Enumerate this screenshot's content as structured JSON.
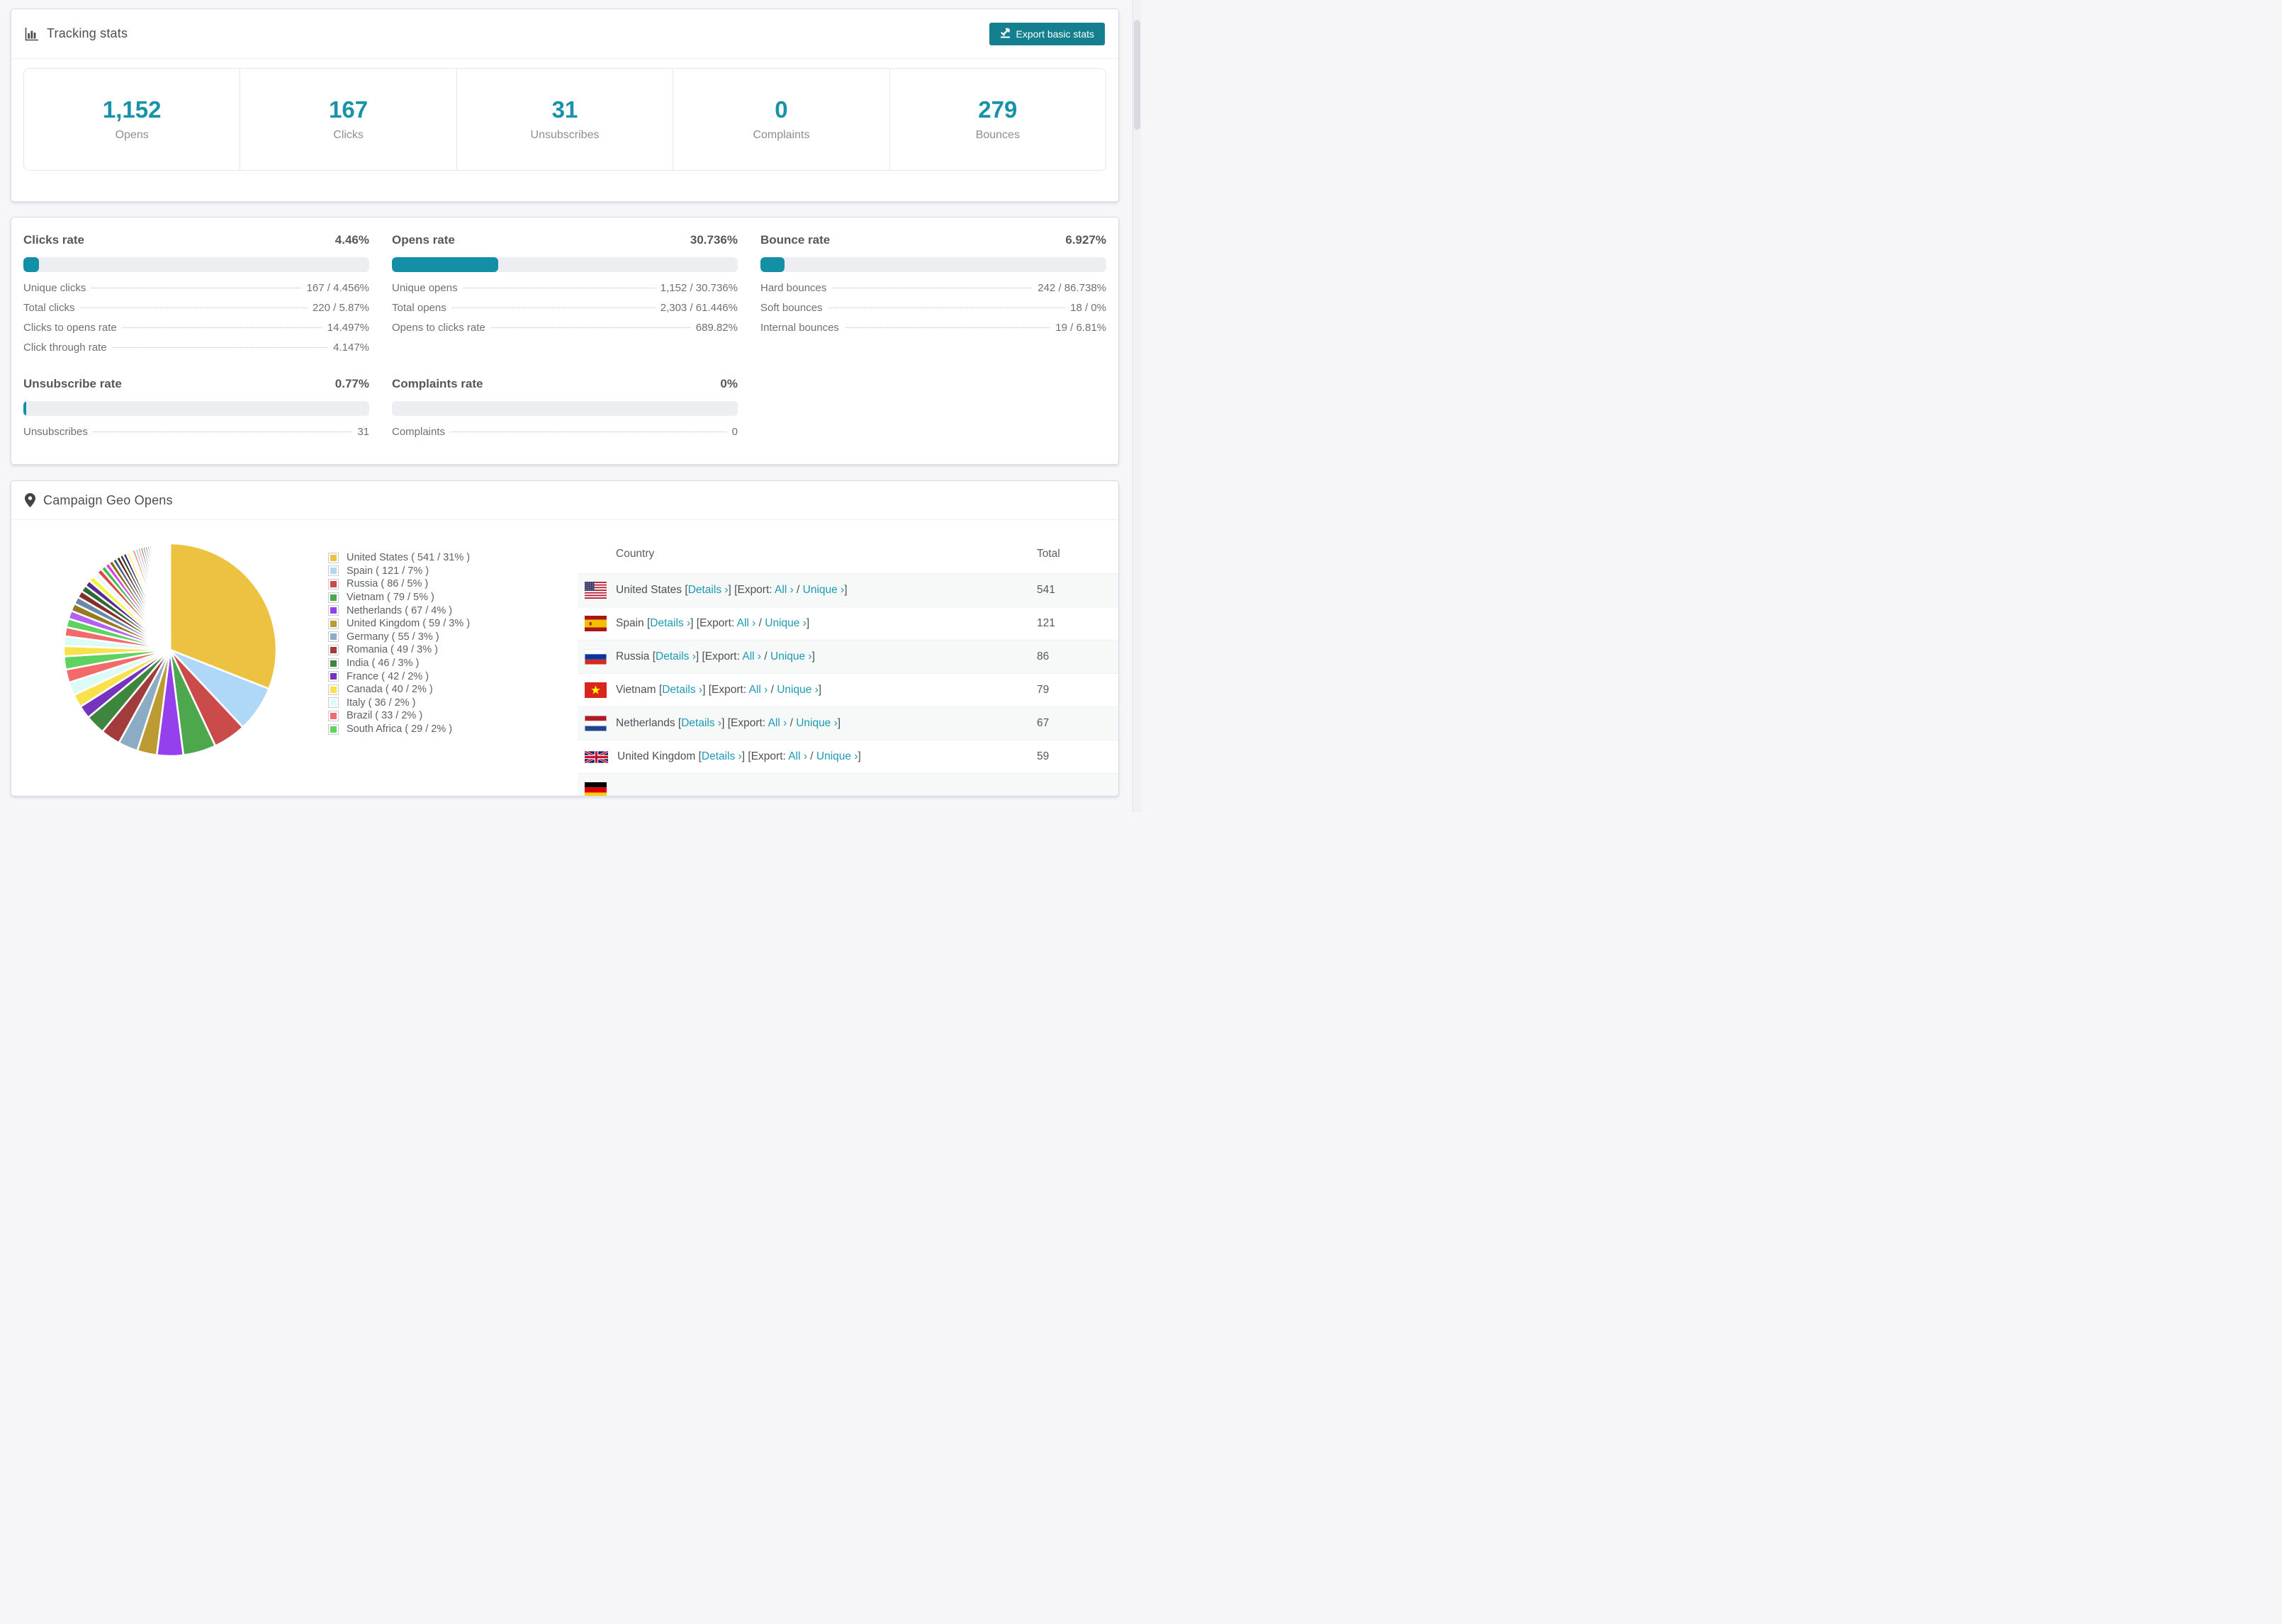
{
  "colors": {
    "accent_teal": "#1892A9",
    "button_teal": "#14808F",
    "link_teal": "#1D9AB2",
    "bar_track": "#EDEEF1",
    "bar_fill": "#1390A5"
  },
  "tracking": {
    "title": "Tracking stats",
    "export_button": "Export basic stats",
    "stats": [
      {
        "value": "1,152",
        "label": "Opens"
      },
      {
        "value": "167",
        "label": "Clicks"
      },
      {
        "value": "31",
        "label": "Unsubscribes"
      },
      {
        "value": "0",
        "label": "Complaints"
      },
      {
        "value": "279",
        "label": "Bounces"
      }
    ]
  },
  "rates": {
    "sections": [
      {
        "id": "clicks",
        "title": "Clicks rate",
        "value": "4.46%",
        "bar_pct": 4.46,
        "grid_row": 1,
        "rows": [
          {
            "label": "Unique clicks",
            "value": "167 / 4.456%"
          },
          {
            "label": "Total clicks",
            "value": "220 / 5.87%"
          },
          {
            "label": "Clicks to opens rate",
            "value": "14.497%"
          },
          {
            "label": "Click through rate",
            "value": "4.147%"
          }
        ]
      },
      {
        "id": "opens",
        "title": "Opens rate",
        "value": "30.736%",
        "bar_pct": 30.736,
        "grid_row": 1,
        "rows": [
          {
            "label": "Unique opens",
            "value": "1,152 / 30.736%"
          },
          {
            "label": "Total opens",
            "value": "2,303 / 61.446%"
          },
          {
            "label": "Opens to clicks rate",
            "value": "689.82%"
          }
        ]
      },
      {
        "id": "bounce",
        "title": "Bounce rate",
        "value": "6.927%",
        "bar_pct": 6.927,
        "grid_row": 1,
        "rows": [
          {
            "label": "Hard bounces",
            "value": "242 / 86.738%"
          },
          {
            "label": "Soft bounces",
            "value": "18 / 0%"
          },
          {
            "label": "Internal bounces",
            "value": "19 / 6.81%"
          }
        ]
      },
      {
        "id": "unsubscribe",
        "title": "Unsubscribe rate",
        "value": "0.77%",
        "bar_pct": 0.77,
        "grid_row": 2,
        "rows": [
          {
            "label": "Unsubscribes",
            "value": "31"
          }
        ]
      },
      {
        "id": "complaints",
        "title": "Complaints rate",
        "value": "0%",
        "bar_pct": 0,
        "grid_row": 2,
        "rows": [
          {
            "label": "Complaints",
            "value": "0"
          }
        ]
      }
    ]
  },
  "geo": {
    "title": "Campaign Geo Opens",
    "table": {
      "headers": {
        "country": "Country",
        "total": "Total"
      },
      "links": {
        "details": "Details",
        "export": "Export:",
        "all": "All",
        "unique": "Unique",
        "chevron": "›"
      },
      "rows": [
        {
          "country": "United States",
          "flag": "us",
          "total": "541"
        },
        {
          "country": "Spain",
          "flag": "es",
          "total": "121"
        },
        {
          "country": "Russia",
          "flag": "ru",
          "total": "86"
        },
        {
          "country": "Vietnam",
          "flag": "vn",
          "total": "79"
        },
        {
          "country": "Netherlands",
          "flag": "nl",
          "total": "67"
        },
        {
          "country": "United Kingdom",
          "flag": "gb",
          "total": "59"
        },
        {
          "country": "",
          "flag": "de",
          "total": "",
          "partial": true
        }
      ]
    }
  },
  "chart_data": {
    "type": "pie",
    "title": "Campaign Geo Opens",
    "legend_position": "right",
    "start_angle_deg": -90,
    "direction": "clockwise",
    "legend_format": "{label} ( {value} / {pct}% )",
    "slices": [
      {
        "label": "United States",
        "value": 541,
        "pct": 31,
        "color": "#EDC240"
      },
      {
        "label": "Spain",
        "value": 121,
        "pct": 7,
        "color": "#AFD8F8"
      },
      {
        "label": "Russia",
        "value": 86,
        "pct": 5,
        "color": "#CB4B4B"
      },
      {
        "label": "Vietnam",
        "value": 79,
        "pct": 5,
        "color": "#4DA74D"
      },
      {
        "label": "Netherlands",
        "value": 67,
        "pct": 4,
        "color": "#9440ED"
      },
      {
        "label": "United Kingdom",
        "value": 59,
        "pct": 3,
        "color": "#BD9B33"
      },
      {
        "label": "Germany",
        "value": 55,
        "pct": 3,
        "color": "#8CACC6"
      },
      {
        "label": "Romania",
        "value": 49,
        "pct": 3,
        "color": "#A23C3C"
      },
      {
        "label": "India",
        "value": 46,
        "pct": 3,
        "color": "#3E863E"
      },
      {
        "label": "France",
        "value": 42,
        "pct": 2,
        "color": "#7633BD"
      },
      {
        "label": "Canada",
        "value": 40,
        "pct": 2,
        "color": "#F9E14C"
      },
      {
        "label": "Italy",
        "value": 36,
        "pct": 2,
        "color": "#DCFBF6"
      },
      {
        "label": "Brazil",
        "value": 33,
        "pct": 2,
        "color": "#F26A6A"
      },
      {
        "label": "South Africa",
        "value": 29,
        "pct": 2,
        "color": "#5FD35F"
      }
    ],
    "others": {
      "note": "unlabeled long tail of small slices",
      "slice_count": 44,
      "total_pct": 26
    }
  }
}
